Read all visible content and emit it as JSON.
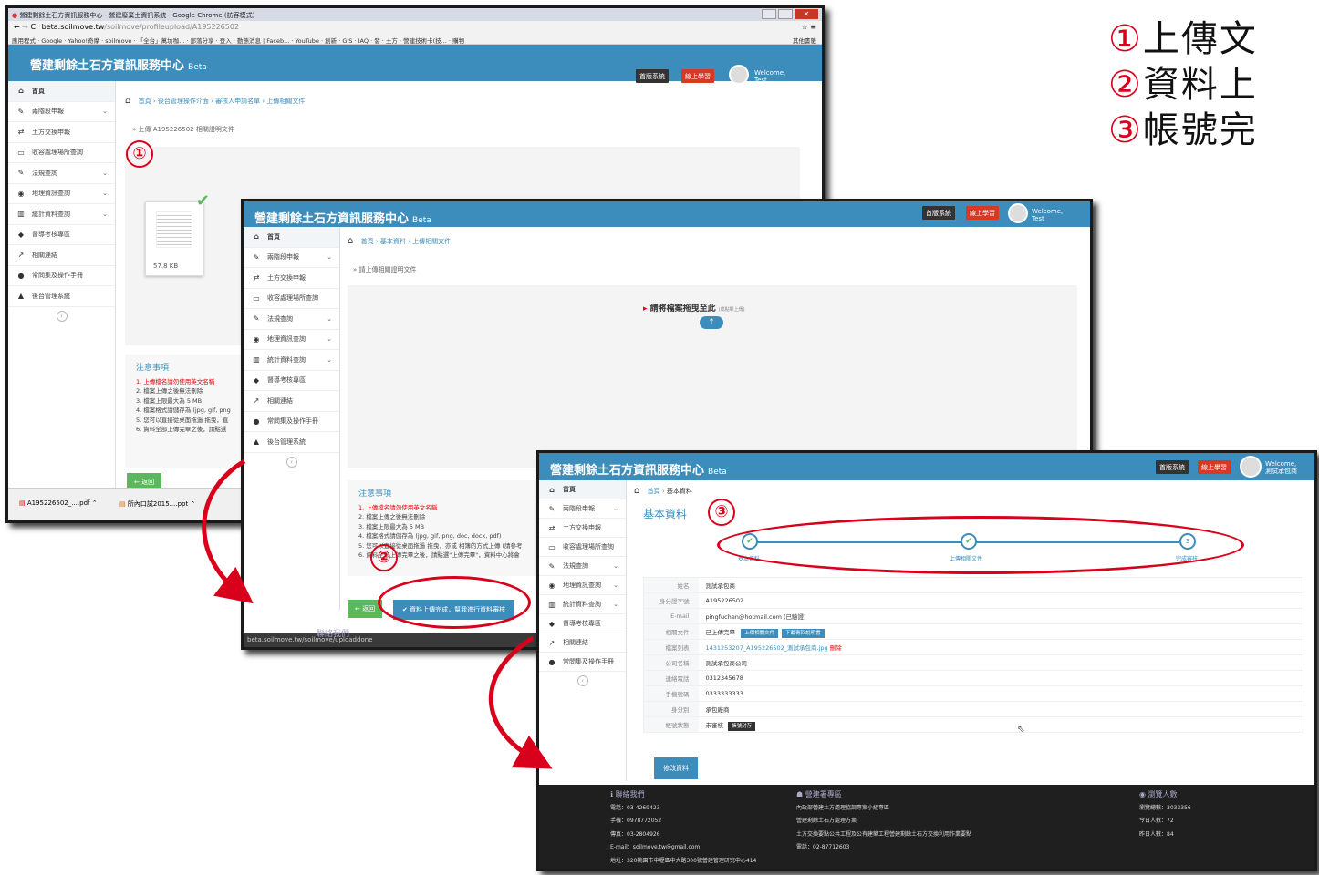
{
  "annotations": [
    {
      "num": "①",
      "text": "上傳文"
    },
    {
      "num": "②",
      "text": "資料上"
    },
    {
      "num": "③",
      "text": "帳號完"
    }
  ],
  "chrome": {
    "title": "營建剩餘土石方資訊服務中心 - 營建廢棄土資訊系統 - Google Chrome (訪客模式)",
    "url_host": "beta.soilmove.tw",
    "url_path": "/soilmove/profileupload/A195226502",
    "bookmarks": [
      "應用程式",
      "Google",
      "Yahoo!奇摩",
      "soilmove",
      "「全台」萬坊咖...",
      "部落分享",
      "登入",
      "動態消息 | Faceb...",
      "YouTube",
      "創新",
      "GIS",
      "IAQ",
      "發",
      "土方",
      "營建技術卡(技...",
      "購物"
    ],
    "bookmarks_right": "其他書籤",
    "downloads": [
      "A195226502_....pdf",
      "所內口試2015....ppt"
    ]
  },
  "site": {
    "brand": "營建剩餘土石方資訊服務中心",
    "beta": "Beta",
    "btn_system": "首版系統",
    "btn_learning": "線上學習",
    "welcome": "Welcome,",
    "user_test": "Test",
    "user_company": "測試承包商",
    "sidebar": [
      "首頁",
      "兩階段申報",
      "土方交換申報",
      "收容處理場所查詢",
      "法規查詢",
      "地理資訊查詢",
      "統計資料查詢",
      "督導考核專區",
      "相關連結",
      "常問集及操作手冊",
      "後台管理系統"
    ]
  },
  "w1": {
    "breadcrumb": [
      "首頁",
      "後台管理操作介面",
      "審核人申請名單",
      "上傳相關文件"
    ],
    "sub": "» 上傳 A195226502 相關證明文件",
    "file_size": "57.8 KB",
    "notes_title": "注意事項",
    "notes": [
      "1. 上傳檔名請勿使用英文名稱",
      "2. 檔案上傳之後無法刪除",
      "3. 檔案上限最大為 5 MB",
      "4. 檔案格式請儲存為 (jpg, gif, png",
      "5. 您可以直接從桌面拖過 拖曳，直",
      "6. 資料全部上傳完畢之後，請點選"
    ],
    "back": "← 返回"
  },
  "w2": {
    "breadcrumb": [
      "首頁",
      "基本資料",
      "上傳相關文件"
    ],
    "sub": "» 請上傳相關證明文件",
    "drop": "請將檔案拖曳至此",
    "drop_small": "(或點擊上傳)",
    "notes_title": "注意事項",
    "notes": [
      "1. 上傳檔名請勿使用英文名稱",
      "2. 檔案上傳之後無法刪除",
      "3. 檔案上限最大為 5 MB",
      "4. 檔案格式請儲存為 (jpg, gif, png, doc, docx, pdf)",
      "5. 您可以直接從桌面拖過 拖曳，亦或 相簿的方式上傳 (請參考",
      "6. 資料全部上傳完畢之後，請點選\"上傳完畢\"，資料中心將會"
    ],
    "back": "← 返回",
    "done": "✔ 資料上傳完成，幫我進行資料審核",
    "status_url": "beta.soilmove.tw/soilmove/uploaddone",
    "footer": "聯絡我們"
  },
  "w3": {
    "breadcrumb": [
      "首頁",
      "基本資料"
    ],
    "title": "基本資料",
    "steps": [
      "基本資料",
      "上傳相關文件",
      "完成審核"
    ],
    "rows": [
      {
        "label": "姓名",
        "value": "測試承包商"
      },
      {
        "label": "身分證字號",
        "value": "A195226502"
      },
      {
        "label": "E-mail",
        "value": "pingfuchen@hotmail.com (已驗證)"
      },
      {
        "label": "相關文件",
        "value": "已上傳完畢"
      },
      {
        "label": "檔案列表",
        "value": "1431253207_A195226502_測試承包商.jpg"
      },
      {
        "label": "公司名稱",
        "value": "測試承包商公司"
      },
      {
        "label": "連絡電話",
        "value": "0312345678"
      },
      {
        "label": "手機號碼",
        "value": "0333333333"
      },
      {
        "label": "身分別",
        "value": "承包廠商"
      },
      {
        "label": "帳號狀態",
        "value": "未審核"
      }
    ],
    "upload_btn": "上傳相關文件",
    "download_btn": "下載寄回說明書",
    "delete": "刪除",
    "status_btn": "帳號封存",
    "edit": "修改資料",
    "footer": {
      "col1_title": "聯絡我們",
      "col1": [
        "電話：03-4269423",
        "手機：0978772052",
        "傳真：03-2804926",
        "E-mail：soilmove.tw@gmail.com",
        "地址：320桃園市中壢區中大路300號營建管理研究中心414"
      ],
      "col2_title": "營建署專區",
      "col2": [
        "內政部營建土方處理協調專案小組專區",
        "營建剩餘土石方處理方案",
        "土方交換要點公共工程及公有建築工程營建剩餘土石方交換利用作業要點",
        "電話：02-87712603"
      ],
      "col3_title": "瀏覽人數",
      "col3": [
        "瀏覽總數：3033356",
        "今日人數：72",
        "昨日人數：84"
      ]
    }
  }
}
